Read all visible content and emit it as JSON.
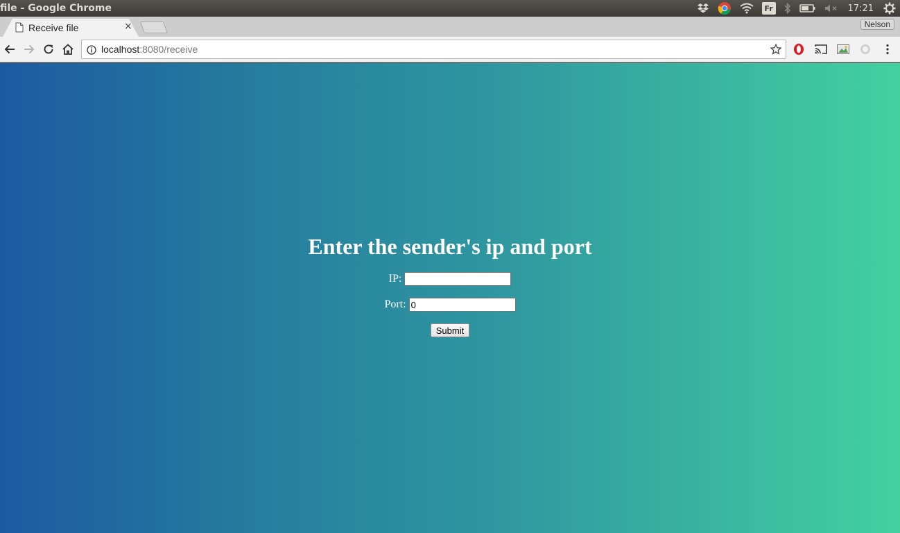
{
  "os_panel": {
    "window_title": "file - Google Chrome",
    "keyboard_layout": "Fr",
    "clock": "17:21"
  },
  "browser": {
    "tab": {
      "title": "Receive file",
      "close_glyph": "×"
    },
    "profile_name": "Nelson",
    "url": {
      "host": "localhost",
      "rest": ":8080/receive"
    }
  },
  "page": {
    "heading": "Enter the sender's ip and port",
    "form": {
      "ip_label": "IP:",
      "ip_value": "",
      "port_label": "Port:",
      "port_value": "0",
      "submit_label": "Submit"
    }
  },
  "colors": {
    "gradient_start": "#1c5aa0",
    "gradient_end": "#43d1a0",
    "os_panel": "#3c3b37",
    "chrome_frame": "#cdcdcd"
  },
  "icons": {
    "os_panel": [
      "dropbox-icon",
      "chrome-icon",
      "wifi-icon",
      "keyboard-layout-indicator",
      "bluetooth-icon",
      "battery-icon",
      "volume-muted-icon",
      "clock",
      "settings-gear-icon"
    ],
    "toolbar": [
      "back-arrow-icon",
      "forward-arrow-icon",
      "reload-icon",
      "home-icon",
      "info-icon",
      "bookmark-star-icon",
      "opera-icon",
      "cast-icon",
      "image-extension-icon",
      "extension-icon",
      "menu-kebab-icon"
    ]
  }
}
